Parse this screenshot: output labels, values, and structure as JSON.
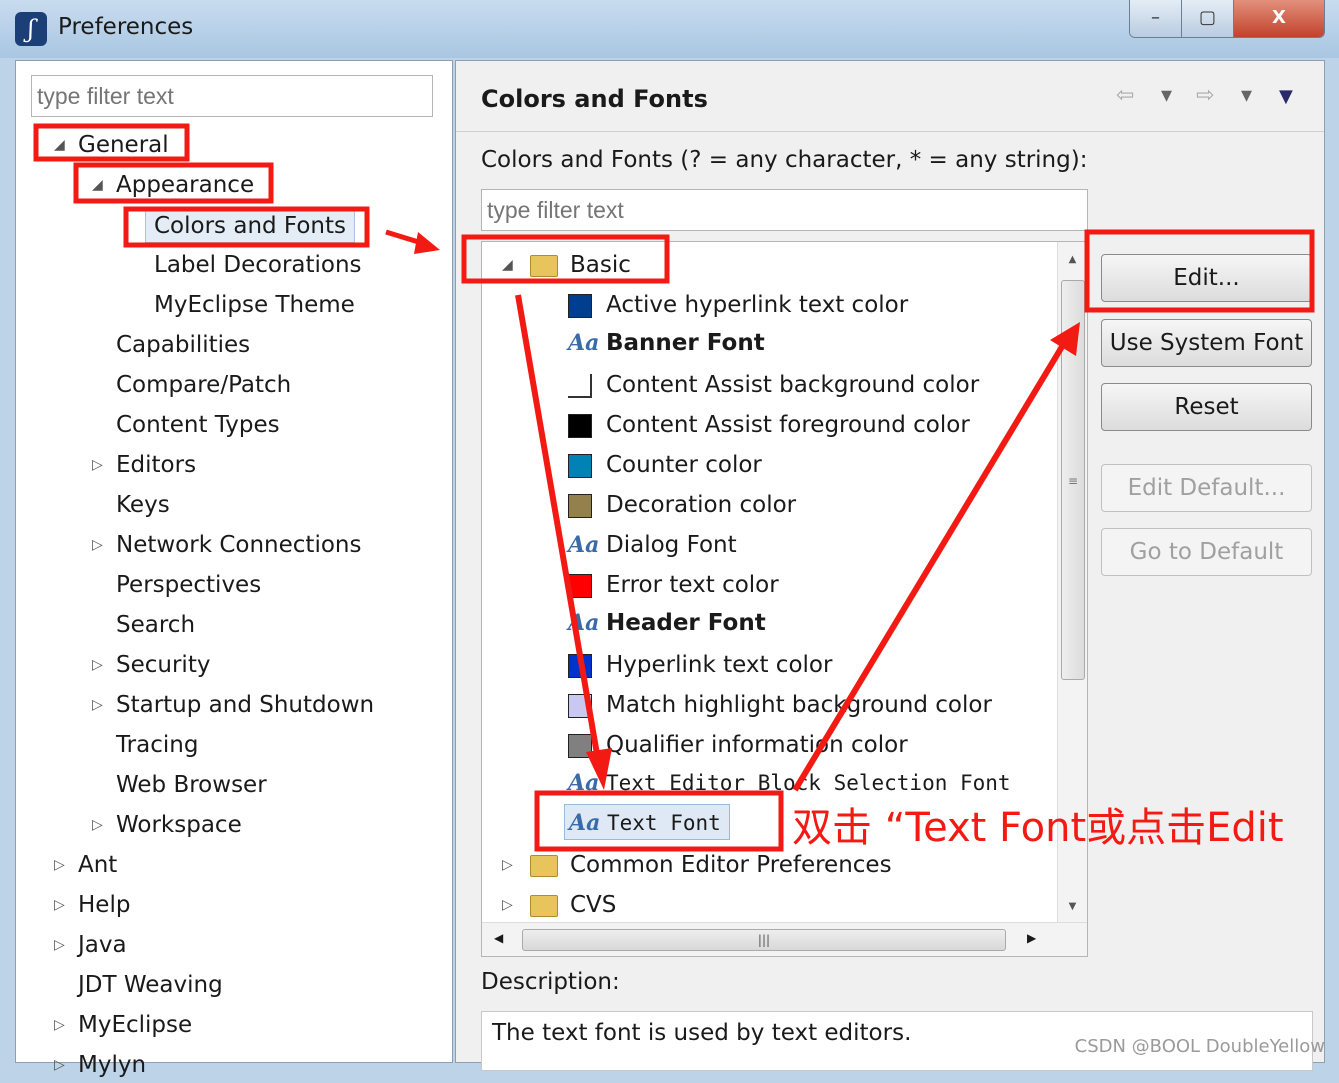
{
  "window": {
    "title": "Preferences",
    "minimize": "–",
    "maximize": "▢",
    "close": "X"
  },
  "left": {
    "filter_placeholder": "type filter text",
    "tree": [
      {
        "label": "General",
        "expanded": true
      },
      {
        "label": "Appearance",
        "expanded": true
      },
      {
        "label": "Colors and Fonts",
        "selected": true
      },
      {
        "label": "Label Decorations"
      },
      {
        "label": "MyEclipse Theme"
      },
      {
        "label": "Capabilities"
      },
      {
        "label": "Compare/Patch"
      },
      {
        "label": "Content Types"
      },
      {
        "label": "Editors",
        "expandable": true
      },
      {
        "label": "Keys"
      },
      {
        "label": "Network Connections",
        "expandable": true
      },
      {
        "label": "Perspectives"
      },
      {
        "label": "Search"
      },
      {
        "label": "Security",
        "expandable": true
      },
      {
        "label": "Startup and Shutdown",
        "expandable": true
      },
      {
        "label": "Tracing"
      },
      {
        "label": "Web Browser"
      },
      {
        "label": "Workspace",
        "expandable": true
      },
      {
        "label": "Ant",
        "expandable": true
      },
      {
        "label": "Help",
        "expandable": true
      },
      {
        "label": "Java",
        "expandable": true
      },
      {
        "label": "JDT Weaving"
      },
      {
        "label": "MyEclipse",
        "expandable": true
      },
      {
        "label": "Mylyn",
        "expandable": true
      }
    ]
  },
  "right": {
    "title": "Colors and Fonts",
    "nav": {
      "back": "⇦",
      "back_menu": "▾",
      "forward": "⇨",
      "forward_menu": "▾",
      "menu": "▼"
    },
    "filter_label": "Colors and Fonts (? = any character, * = any string):",
    "filter_placeholder": "type filter text",
    "tree": [
      {
        "label": "Basic",
        "type": "folder",
        "expanded": true
      },
      {
        "label": "Active hyperlink text color",
        "type": "color",
        "color": "#003f8f"
      },
      {
        "label": "Banner Font",
        "type": "font",
        "bold": true
      },
      {
        "label": "Content Assist background color",
        "type": "color",
        "color": "#ffffff"
      },
      {
        "label": "Content Assist foreground color",
        "type": "color",
        "color": "#000000"
      },
      {
        "label": "Counter color",
        "type": "color",
        "color": "#0082b4"
      },
      {
        "label": "Decoration color",
        "type": "color",
        "color": "#94804c"
      },
      {
        "label": "Dialog Font",
        "type": "font"
      },
      {
        "label": "Error text color",
        "type": "color",
        "color": "#ff0000"
      },
      {
        "label": "Header Font",
        "type": "font",
        "bold": true
      },
      {
        "label": "Hyperlink text color",
        "type": "color",
        "color": "#0033cc"
      },
      {
        "label": "Match highlight background color",
        "type": "color",
        "color": "#c8c8f0"
      },
      {
        "label": "Qualifier information color",
        "type": "color",
        "color": "#808080"
      },
      {
        "label": "Text Editor Block Selection Font",
        "type": "font",
        "mono": true
      },
      {
        "label": "Text Font",
        "type": "font",
        "mono": true,
        "selected": true
      },
      {
        "label": "Common Editor Preferences",
        "type": "folder"
      },
      {
        "label": "CVS",
        "type": "folder"
      }
    ],
    "buttons": {
      "edit": "Edit...",
      "use_system_font": "Use System Font",
      "reset": "Reset",
      "edit_default": "Edit Default...",
      "go_to_default": "Go to Default"
    },
    "description_label": "Description:",
    "description": "The text font is used by text editors."
  },
  "annotation": {
    "note": "双击 “Text Font或点击Edit",
    "color": "#f21a12"
  },
  "watermark": "CSDN @BOOL DoubleYellow"
}
